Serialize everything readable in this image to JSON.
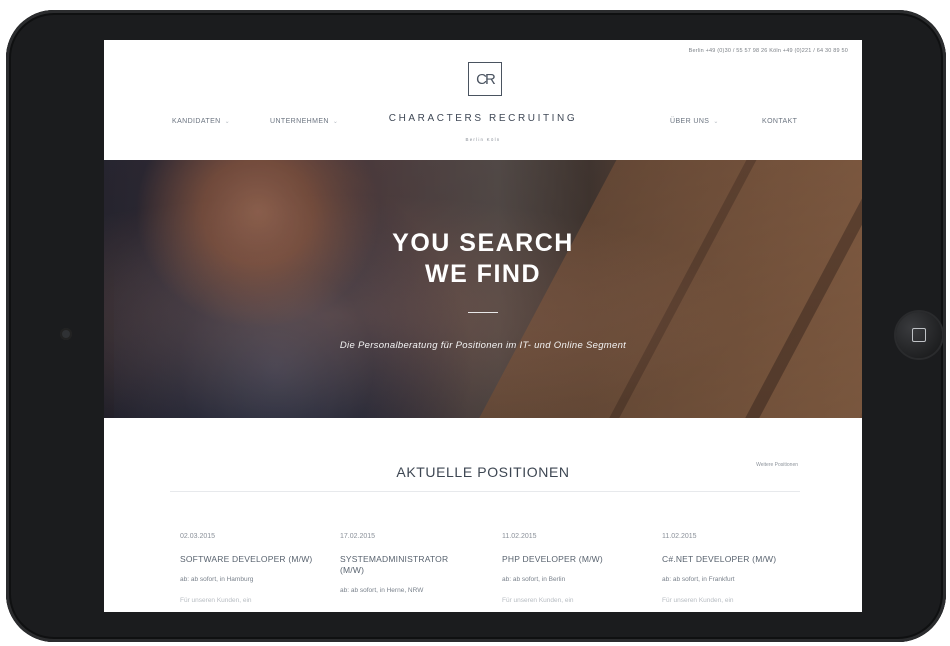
{
  "header": {
    "contact": "Berlin +49 (0)30 / 55 57 98 26    Köln +49 (0)221 / 64 30 89 50",
    "logo_mark": "CR",
    "brand": "CHARACTERS RECRUITING",
    "sub_brand": "Berlin   Köln",
    "nav": [
      {
        "label": "KANDIDATEN",
        "has_dropdown": true
      },
      {
        "label": "UNTERNEHMEN",
        "has_dropdown": true
      },
      {
        "label": "ÜBER UNS",
        "has_dropdown": true
      },
      {
        "label": "KONTAKT",
        "has_dropdown": false
      }
    ]
  },
  "hero": {
    "title_line1": "YOU SEARCH",
    "title_line2": "WE FIND",
    "subtitle": "Die Personalberatung für Positionen im IT- und Online Segment"
  },
  "positions": {
    "title": "AKTUELLE POSITIONEN",
    "more_link": "Weitere Positionen",
    "jobs": [
      {
        "date": "02.03.2015",
        "title": "SOFTWARE DEVELOPER (M/W)",
        "meta": "ab: ab sofort, in Hamburg",
        "teaser": "Für unseren Kunden, ein"
      },
      {
        "date": "17.02.2015",
        "title": "SYSTEMADMINISTRATOR (M/W)",
        "meta": "ab: ab sofort, in Herne, NRW",
        "teaser": ""
      },
      {
        "date": "11.02.2015",
        "title": "PHP DEVELOPER (M/W)",
        "meta": "ab: ab sofort, in Berlin",
        "teaser": "Für unseren Kunden, ein"
      },
      {
        "date": "11.02.2015",
        "title": "C#.NET DEVELOPER (M/W)",
        "meta": "ab: ab sofort, in Frankfurt",
        "teaser": "Für unseren Kunden, ein"
      }
    ]
  },
  "colors": {
    "device_frame": "#1b1c1e",
    "brand_text": "#3f4856",
    "accent_line": "#e7e9ec"
  }
}
